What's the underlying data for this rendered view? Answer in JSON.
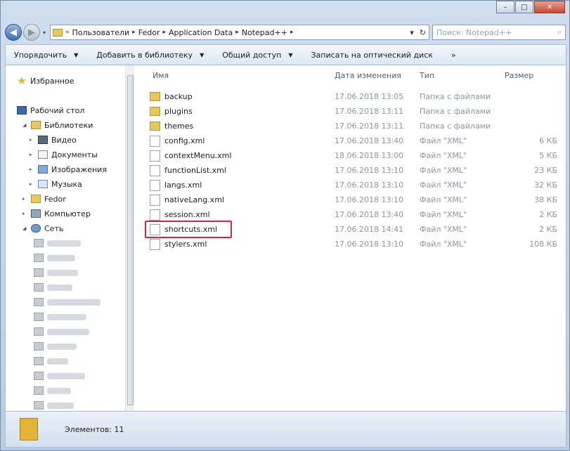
{
  "window": {
    "minimize_icon": "minimize-icon",
    "maximize_icon": "maximize-icon",
    "close_icon": "close-icon",
    "min_glyph": "–",
    "max_glyph": "□",
    "close_glyph": "✕"
  },
  "nav": {
    "back_glyph": "◀",
    "forward_glyph": "▶",
    "history_glyph": "▾"
  },
  "address": {
    "lead": "«",
    "crumbs": [
      "Пользователи",
      "Fedor",
      "Application Data",
      "Notepad++"
    ],
    "separator": "▸",
    "dropdown": "▾",
    "refresh": "↻"
  },
  "search": {
    "placeholder": "Поиск: Notepad++",
    "icon": "⌕"
  },
  "toolbar": {
    "organize": "Упорядочить",
    "include": "Добавить в библиотеку",
    "share": "Общий доступ",
    "burn": "Записать на оптический диск",
    "more": "»",
    "arrow": "▼"
  },
  "navpane": {
    "favorites": "Избранное",
    "desktop": "Рабочий стол",
    "libraries": "Библиотеки",
    "video": "Видео",
    "documents": "Документы",
    "images": "Изображения",
    "music": "Музыка",
    "home": "Fedor",
    "computer": "Компьютер",
    "network": "Сеть",
    "expand_glyph": "▸",
    "open_glyph": "◢"
  },
  "columns": {
    "name": "Имя",
    "date": "Дата изменения",
    "type": "Тип",
    "size": "Размер"
  },
  "files": [
    {
      "name": "backup",
      "date": "17.06.2018 13:05",
      "type": "Папка с файлами",
      "size": "",
      "icon": "folder-icon"
    },
    {
      "name": "plugins",
      "date": "17.06.2018 13:11",
      "type": "Папка с файлами",
      "size": "",
      "icon": "folder-icon"
    },
    {
      "name": "themes",
      "date": "17.06.2018 13:11",
      "type": "Папка с файлами",
      "size": "",
      "icon": "folder-icon"
    },
    {
      "name": "config.xml",
      "date": "17.06.2018 13:40",
      "type": "Файл \"XML\"",
      "size": "6 КБ",
      "icon": "xml-file-icon"
    },
    {
      "name": "contextMenu.xml",
      "date": "18.06.2018 13:00",
      "type": "Файл \"XML\"",
      "size": "5 КБ",
      "icon": "xml-file-icon"
    },
    {
      "name": "functionList.xml",
      "date": "17.06.2018 13:10",
      "type": "Файл \"XML\"",
      "size": "23 КБ",
      "icon": "xml-file-icon"
    },
    {
      "name": "langs.xml",
      "date": "17.06.2018 13:10",
      "type": "Файл \"XML\"",
      "size": "32 КБ",
      "icon": "xml-file-icon"
    },
    {
      "name": "nativeLang.xml",
      "date": "17.06.2018 13:10",
      "type": "Файл \"XML\"",
      "size": "38 КБ",
      "icon": "xml-file-icon"
    },
    {
      "name": "session.xml",
      "date": "17.06.2018 13:40",
      "type": "Файл \"XML\"",
      "size": "2 КБ",
      "icon": "xml-file-icon"
    },
    {
      "name": "shortcuts.xml",
      "date": "17.06.2018 14:41",
      "type": "Файл \"XML\"",
      "size": "2 КБ",
      "icon": "xml-file-icon"
    },
    {
      "name": "stylers.xml",
      "date": "17.06.2018 13:10",
      "type": "Файл \"XML\"",
      "size": "108 КБ",
      "icon": "xml-file-icon"
    }
  ],
  "status": {
    "label": "Элементов: 11"
  }
}
